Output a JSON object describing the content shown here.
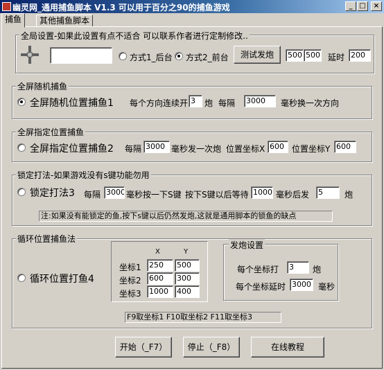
{
  "window": {
    "title": "幽灵网_通用捕鱼脚本 V1.3   可以用于百分之90的捕鱼游戏",
    "buttons": {
      "minimize": "_",
      "maximize": "□",
      "close": "×"
    }
  },
  "tabs": [
    {
      "label": "捕鱼"
    },
    {
      "label": "其他捕鱼脚本"
    }
  ],
  "global": {
    "title": "全局设置-如果此设置有点不适合 可以联系作者进行定制修改..",
    "window_input": "",
    "mode1_label": "方式1_后台",
    "mode2_label": "方式2_前台",
    "test_button": "测试发炮",
    "val1": "500",
    "val2": "500",
    "delay_label": "延时",
    "delay_value": "200"
  },
  "random": {
    "title": "全屏随机捕鱼",
    "radio_label": "全屏随机位置捕鱼1",
    "consecutive_label": "每个方向连续开",
    "consecutive_value": "3",
    "shot_unit": "炮",
    "interval_label": "每隔",
    "interval_value": "3000",
    "interval_suffix": "毫秒换一次方向"
  },
  "fixed": {
    "title": "全屏指定位置捕鱼",
    "radio_label": "全屏指定位置捕鱼2",
    "interval_label": "每隔",
    "interval_value": "3000",
    "interval_suffix": "毫秒发一次炮",
    "x_label": "位置坐标X",
    "x_value": "600",
    "y_label": "位置坐标Y",
    "y_value": "600"
  },
  "lock": {
    "title": "锁定打法-如果游戏没有s键功能勿用",
    "radio_label": "锁定打法3",
    "interval_label": "每隔",
    "interval_value": "3000",
    "press_label": "毫秒按一下S键",
    "wait_label": "按下S键以后等待",
    "wait_value": "1000",
    "fire_label": "毫秒后发",
    "fire_value": "5",
    "shot_unit": "炮",
    "note": "注:如果没有能锁定的鱼,按下s键以后仍然发炮,这就是通用脚本的锁鱼的缺点"
  },
  "loop": {
    "title": "循环位置捕鱼法",
    "radio_label": "循环位置打鱼4",
    "col_x": "X",
    "col_y": "Y",
    "rows": [
      {
        "label": "坐标1",
        "x": "250",
        "y": "500"
      },
      {
        "label": "坐标2",
        "x": "600",
        "y": "300"
      },
      {
        "label": "坐标3",
        "x": "1000",
        "y": "400"
      }
    ],
    "fire_title": "发炮设置",
    "per_coord_label": "每个坐标打",
    "per_coord_value": "3",
    "shot_unit": "炮",
    "delay_label": "每个坐标延时",
    "delay_value": "3000",
    "delay_unit": "毫秒",
    "hotkeys": "F9取坐标1 F10取坐标2 F11取坐标3"
  },
  "footer": {
    "start": "开始（_F7）",
    "stop": "停止（_F8）",
    "tutorial": "在线教程"
  }
}
